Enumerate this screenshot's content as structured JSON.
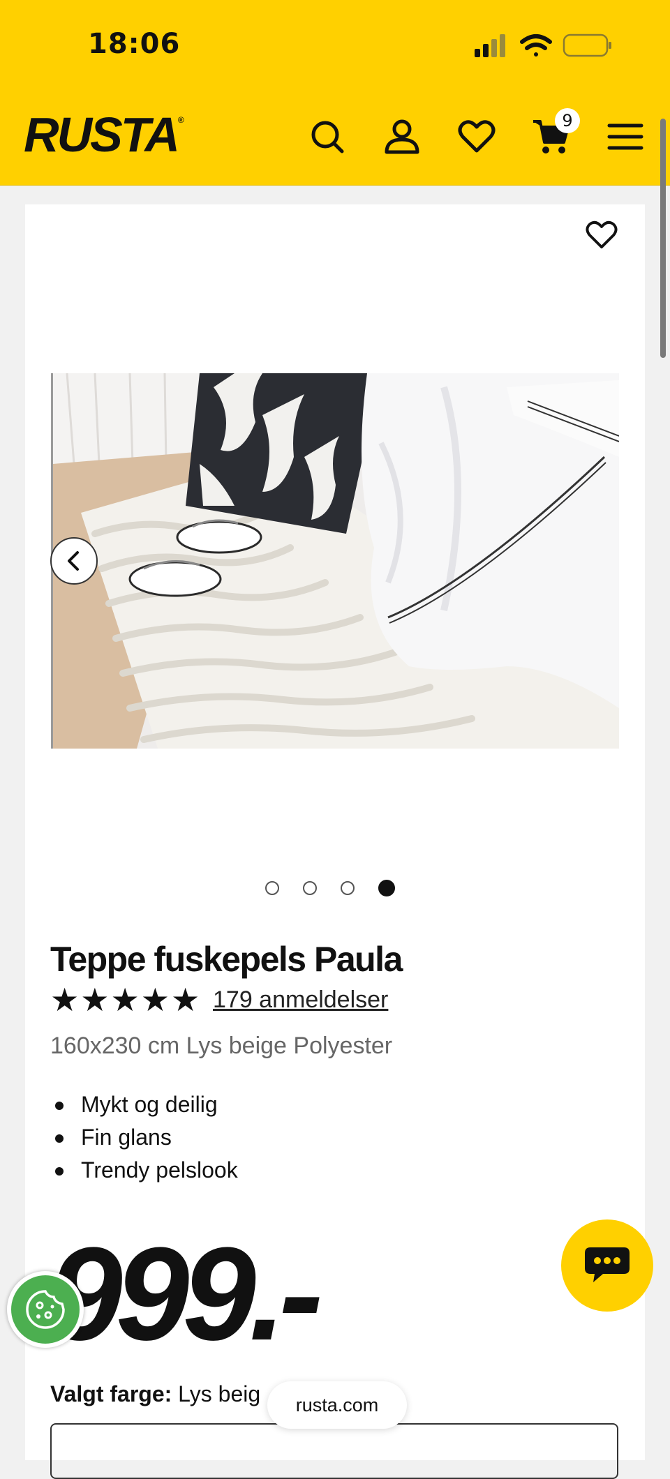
{
  "status_bar": {
    "time": "18:06",
    "icons": [
      "signal-icon",
      "wifi-icon",
      "battery-icon"
    ]
  },
  "header": {
    "logo": "RUSTA",
    "logo_mark": "®",
    "cart_count": "9",
    "icons": [
      "search-icon",
      "account-icon",
      "heart-icon",
      "cart-icon",
      "menu-icon"
    ],
    "background": "#ffd000"
  },
  "gallery": {
    "slide_count": 4,
    "active_slide": 4
  },
  "product": {
    "title": "Teppe fuskepels Paula",
    "rating": 5,
    "stars": [
      "★",
      "★",
      "★",
      "★",
      "★"
    ],
    "reviews_label": "179 anmeldelser",
    "specs": "160x230 cm Lys beige Polyester",
    "features": [
      "Mykt og deilig",
      "Fin glans",
      "Trendy pelslook"
    ],
    "price": "999.-",
    "color_label": "Valgt farge:",
    "color_value": "Lys beig"
  },
  "floating": {
    "url": "rusta.com",
    "chat_icon": "chat-icon",
    "cookie_icon": "cookie-icon"
  },
  "colors": {
    "accent": "#ffd000",
    "cookie": "#4caf50"
  }
}
